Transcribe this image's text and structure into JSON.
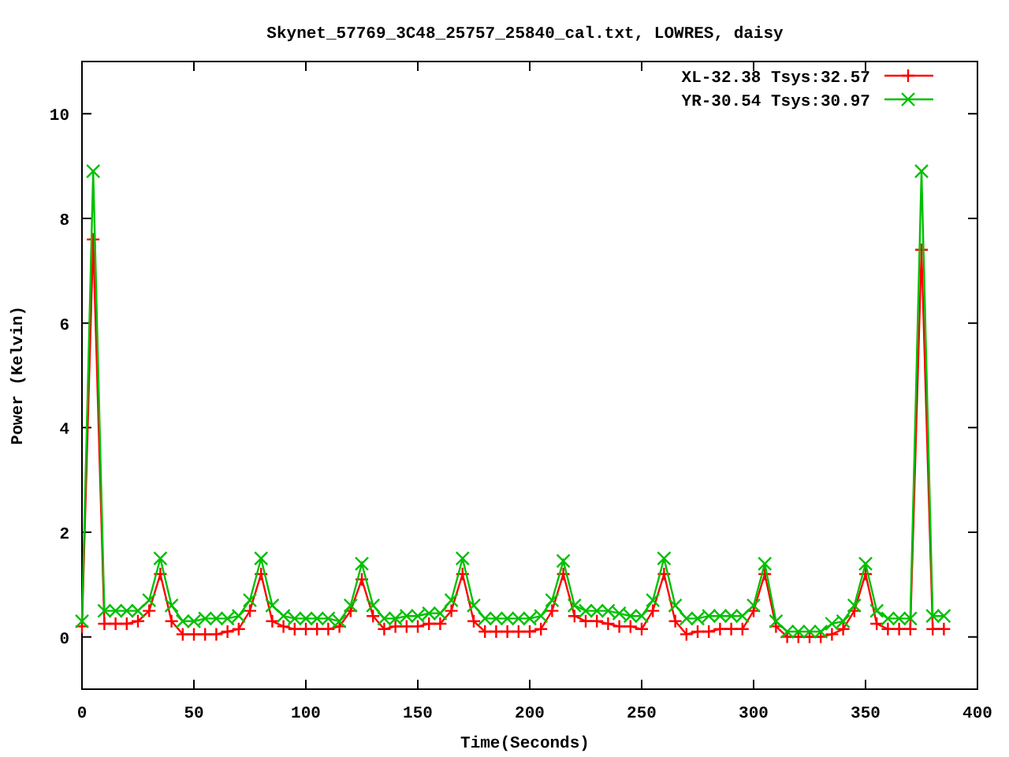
{
  "chart_data": {
    "type": "line",
    "title": "Skynet_57769_3C48_25757_25840_cal.txt, LOWRES, daisy",
    "xlabel": "Time(Seconds)",
    "ylabel": "Power (Kelvin)",
    "x": [
      0,
      5,
      10,
      15,
      20,
      25,
      30,
      35,
      40,
      45,
      50,
      55,
      60,
      65,
      70,
      75,
      80,
      85,
      90,
      95,
      100,
      105,
      110,
      115,
      120,
      125,
      130,
      135,
      140,
      145,
      150,
      155,
      160,
      165,
      170,
      175,
      180,
      185,
      190,
      195,
      200,
      205,
      210,
      215,
      220,
      225,
      230,
      235,
      240,
      245,
      250,
      255,
      260,
      265,
      270,
      275,
      280,
      285,
      290,
      295,
      300,
      305,
      310,
      315,
      320,
      325,
      330,
      335,
      340,
      345,
      350,
      355,
      360,
      365,
      370,
      375,
      380,
      385
    ],
    "series": [
      {
        "name": "XL-32.38 Tsys:32.57",
        "color": "#ff0000",
        "marker": "plus",
        "values": [
          0.2,
          7.6,
          0.25,
          0.25,
          0.25,
          0.3,
          0.5,
          1.2,
          0.3,
          0.05,
          0.05,
          0.05,
          0.05,
          0.1,
          0.15,
          0.5,
          1.2,
          0.3,
          0.2,
          0.15,
          0.15,
          0.15,
          0.15,
          0.2,
          0.5,
          1.1,
          0.4,
          0.15,
          0.2,
          0.2,
          0.2,
          0.25,
          0.25,
          0.5,
          1.2,
          0.3,
          0.1,
          0.1,
          0.1,
          0.1,
          0.1,
          0.15,
          0.5,
          1.2,
          0.4,
          0.3,
          0.3,
          0.25,
          0.2,
          0.2,
          0.15,
          0.5,
          1.2,
          0.3,
          0.05,
          0.1,
          0.1,
          0.15,
          0.15,
          0.15,
          0.5,
          1.2,
          0.2,
          0.0,
          0.0,
          0.0,
          0.0,
          0.05,
          0.15,
          0.5,
          1.2,
          0.25,
          0.15,
          0.15,
          0.15,
          7.4,
          0.15,
          0.15
        ]
      },
      {
        "name": "YR-30.54 Tsys:30.97",
        "color": "#00c000",
        "marker": "cross",
        "values": [
          0.3,
          8.9,
          0.5,
          0.5,
          0.5,
          0.5,
          0.7,
          1.5,
          0.6,
          0.3,
          0.3,
          0.35,
          0.35,
          0.35,
          0.4,
          0.7,
          1.5,
          0.6,
          0.4,
          0.35,
          0.35,
          0.35,
          0.35,
          0.3,
          0.6,
          1.4,
          0.6,
          0.35,
          0.35,
          0.4,
          0.4,
          0.45,
          0.45,
          0.7,
          1.5,
          0.6,
          0.35,
          0.35,
          0.35,
          0.35,
          0.35,
          0.4,
          0.7,
          1.45,
          0.6,
          0.5,
          0.5,
          0.5,
          0.45,
          0.4,
          0.4,
          0.7,
          1.5,
          0.6,
          0.35,
          0.35,
          0.4,
          0.4,
          0.4,
          0.4,
          0.6,
          1.4,
          0.3,
          0.1,
          0.1,
          0.1,
          0.1,
          0.25,
          0.3,
          0.6,
          1.4,
          0.5,
          0.35,
          0.35,
          0.35,
          8.9,
          0.4,
          0.4
        ]
      }
    ],
    "legend": true,
    "xlim": [
      0,
      400
    ],
    "ylim": [
      -1,
      11
    ],
    "xticks": [
      0,
      50,
      100,
      150,
      200,
      250,
      300,
      350,
      400
    ],
    "yticks": [
      0,
      2,
      4,
      6,
      8,
      10
    ]
  }
}
